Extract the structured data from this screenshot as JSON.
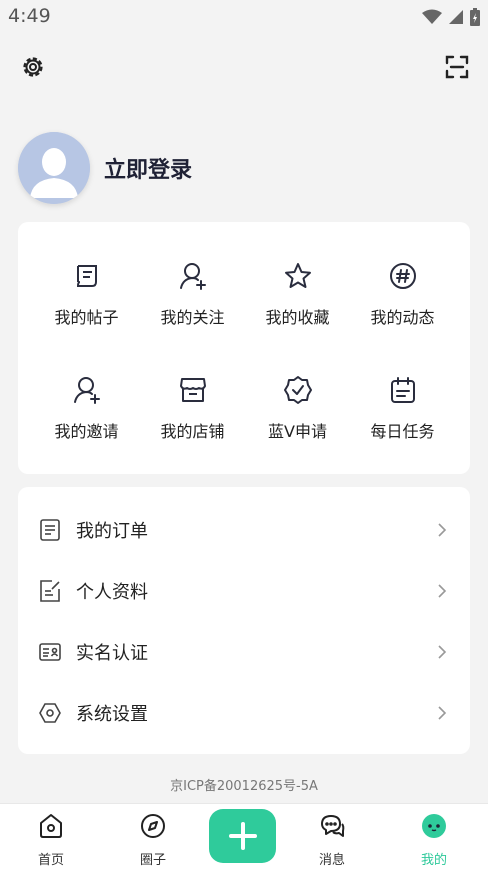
{
  "status_bar": {
    "time": "4:49"
  },
  "header": {
    "settings_icon": "gear-icon",
    "scan_icon": "scan-icon"
  },
  "profile": {
    "login_label": "立即登录"
  },
  "grid": {
    "items": [
      {
        "label": "我的帖子",
        "icon": "post-icon"
      },
      {
        "label": "我的关注",
        "icon": "follow-user-icon"
      },
      {
        "label": "我的收藏",
        "icon": "star-icon"
      },
      {
        "label": "我的动态",
        "icon": "hashtag-icon"
      },
      {
        "label": "我的邀请",
        "icon": "invite-user-icon"
      },
      {
        "label": "我的店铺",
        "icon": "store-icon"
      },
      {
        "label": "蓝V申请",
        "icon": "verified-badge-icon"
      },
      {
        "label": "每日任务",
        "icon": "calendar-task-icon"
      }
    ]
  },
  "list": {
    "items": [
      {
        "label": "我的订单",
        "icon": "order-icon"
      },
      {
        "label": "个人资料",
        "icon": "edit-profile-icon"
      },
      {
        "label": "实名认证",
        "icon": "id-card-icon"
      },
      {
        "label": "系统设置",
        "icon": "hexagon-settings-icon"
      }
    ]
  },
  "footer": {
    "icp": "京ICP备20012625号-5A"
  },
  "tabbar": {
    "tabs": [
      {
        "label": "首页",
        "icon": "home-icon"
      },
      {
        "label": "圈子",
        "icon": "compass-icon"
      },
      {
        "label": "消息",
        "icon": "chat-icon"
      },
      {
        "label": "我的",
        "icon": "profile-face-icon"
      }
    ],
    "active_tab": "我的",
    "accent_color": "#2fcb9b"
  }
}
